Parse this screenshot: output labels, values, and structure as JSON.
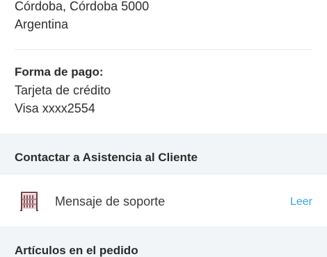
{
  "shipping_address": {
    "line1": "Córdoba, Córdoba 5000",
    "line2": "Argentina"
  },
  "payment": {
    "heading": "Forma de pago:",
    "method": "Tarjeta de crédito",
    "card": "Visa xxxx2554"
  },
  "support": {
    "section_title": "Contactar a Asistencia al Cliente",
    "message_label": "Mensaje de soporte",
    "action_label": "Leer",
    "thumbnail_icon": "product-thumbnail-icon",
    "accent_color": "#35a8d8"
  },
  "items": {
    "section_title": "Artículos en el pedido"
  }
}
